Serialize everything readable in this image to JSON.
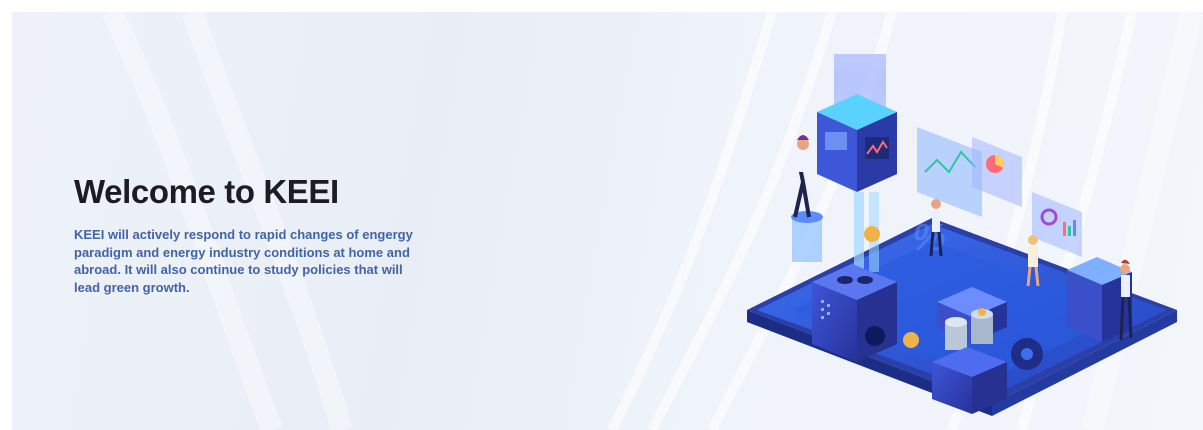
{
  "hero": {
    "title": "Welcome to KEEI",
    "description": "KEEI will actively respond to rapid changes of engergy paradigm and energy industry conditions at home and abroad. It will also continue to study policies that will lead green growth."
  },
  "colors": {
    "background": "#eef2f8",
    "title": "#1c1c22",
    "description": "#4163a8",
    "platform": "#2f55d6",
    "accent": "#f2b24a"
  },
  "illustration": {
    "icon": "energy-industry-isometric-illustration"
  }
}
